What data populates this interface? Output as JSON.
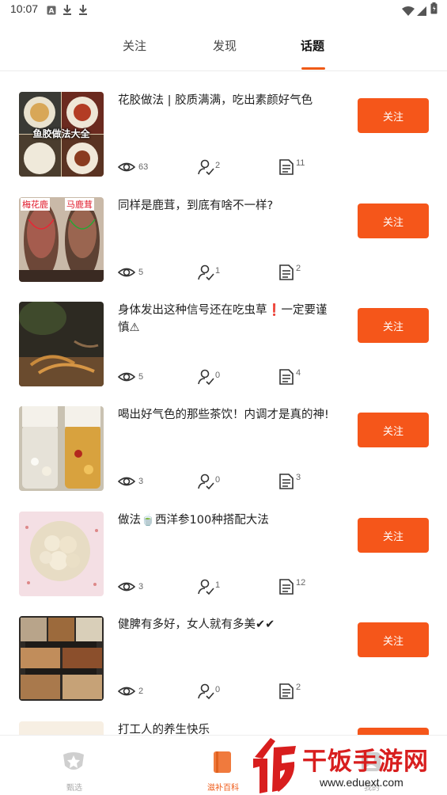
{
  "status_bar": {
    "time": "10:07"
  },
  "tabs": [
    {
      "label": "关注",
      "active": false
    },
    {
      "label": "发现",
      "active": false
    },
    {
      "label": "话题",
      "active": true
    }
  ],
  "accent_color": "#f5561a",
  "topics": [
    {
      "title": "花胶做法 | 胶质满满，吃出素颜好气色",
      "thumb_caption": "鱼胶做法大全",
      "views": "63",
      "followers": "2",
      "posts": "11",
      "follow_label": "关注"
    },
    {
      "title": "同样是鹿茸，到底有啥不一样?",
      "thumb_caption_left": "梅花鹿",
      "thumb_caption_right": "马鹿茸",
      "views": "5",
      "followers": "1",
      "posts": "2",
      "follow_label": "关注"
    },
    {
      "title": "身体发出这种信号还在吃虫草❗一定要谨慎⚠",
      "views": "5",
      "followers": "0",
      "posts": "4",
      "follow_label": "关注"
    },
    {
      "title": "喝出好气色的那些茶饮！内调才是真的神!",
      "views": "3",
      "followers": "0",
      "posts": "3",
      "follow_label": "关注"
    },
    {
      "title": "做法🍵西洋参100种搭配大法",
      "views": "3",
      "followers": "1",
      "posts": "12",
      "follow_label": "关注"
    },
    {
      "title": "健脾有多好，女人就有多美✔✔",
      "views": "2",
      "followers": "0",
      "posts": "2",
      "follow_label": "关注"
    },
    {
      "title": "打工人的养生快乐",
      "follow_label": "关注"
    }
  ],
  "bottom_nav": [
    {
      "label": "甄选",
      "icon": "star-badge-icon"
    },
    {
      "label": "滋补百科",
      "icon": "book-icon",
      "active": true
    },
    {
      "label": "我的",
      "icon": "profile-icon"
    }
  ],
  "watermark": {
    "title": "干饭手游网",
    "url": "www.eduext.com"
  }
}
